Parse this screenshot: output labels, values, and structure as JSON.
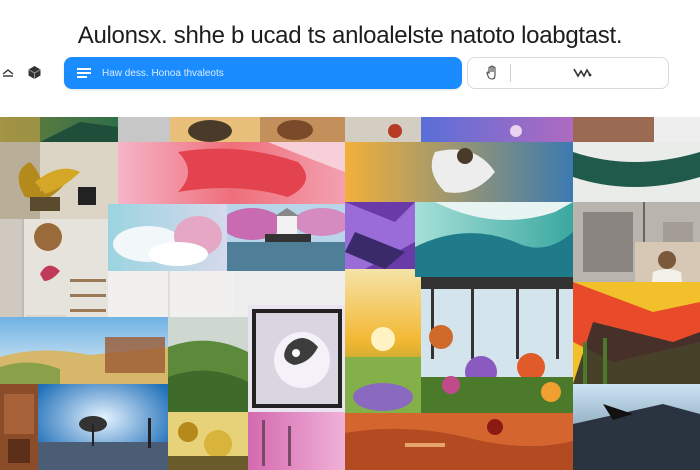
{
  "header": {
    "headline": "Aulonsx. shhe b ucad ts anloalelste natoto loabgtast."
  },
  "search": {
    "placeholder": "Haw dess. Honoa thvaleots"
  },
  "icons": {
    "left": [
      "share-icon",
      "cube-icon"
    ],
    "search_menu": "menu-icon",
    "right_hand": "hand-icon",
    "right_logo": "logo-icon"
  },
  "colors": {
    "accent": "#1a8cff",
    "headline": "#1d1d1f"
  },
  "gallery": {
    "tiles": [
      {
        "name": "tile-leaves-top"
      },
      {
        "name": "tile-gray-panel"
      },
      {
        "name": "tile-sculpture-orange"
      },
      {
        "name": "tile-red-lamp"
      },
      {
        "name": "tile-blue-purple"
      },
      {
        "name": "tile-brown-wall"
      },
      {
        "name": "tile-plant-still-life"
      },
      {
        "name": "tile-pink-ribbon"
      },
      {
        "name": "tile-yellow-figure"
      },
      {
        "name": "tile-teal-ribbon"
      },
      {
        "name": "tile-interior-shelf"
      },
      {
        "name": "tile-pink-clouds"
      },
      {
        "name": "tile-lake-pagoda"
      },
      {
        "name": "tile-abstract-purple"
      },
      {
        "name": "tile-teal-landscape"
      },
      {
        "name": "tile-gray-interior"
      },
      {
        "name": "tile-figure-chair"
      },
      {
        "name": "tile-white-wall"
      },
      {
        "name": "tile-sunset-field"
      },
      {
        "name": "tile-garden-greenhouse"
      },
      {
        "name": "tile-yellow-abstract"
      },
      {
        "name": "tile-sea-landscape"
      },
      {
        "name": "tile-green-hill"
      },
      {
        "name": "tile-mirror-flowers"
      },
      {
        "name": "tile-brick-tower"
      },
      {
        "name": "tile-sky-satellite"
      },
      {
        "name": "tile-golden-flowers"
      },
      {
        "name": "tile-pink-sticks"
      },
      {
        "name": "tile-purple-mound"
      },
      {
        "name": "tile-red-floor"
      },
      {
        "name": "tile-dark-plane"
      }
    ]
  }
}
